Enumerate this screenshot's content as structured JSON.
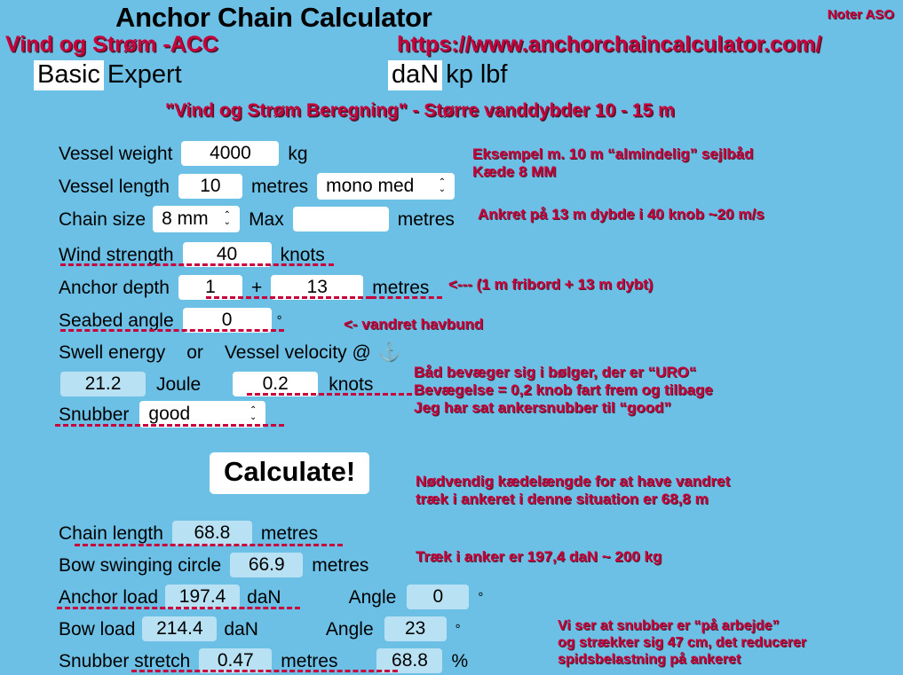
{
  "header": {
    "app_title": "Anchor Chain Calculator",
    "noter": "Noter ASO",
    "subtitle_left": "Vind og Strøm -ACC",
    "url": "https://www.anchorchaincalculator.com/",
    "banner": "\"Vind og Strøm Beregning\" - Større vanddybder 10 - 15 m"
  },
  "mode_tabs": {
    "basic": "Basic",
    "expert": "Expert",
    "selected": "Basic"
  },
  "unit_tabs": {
    "dan": "daN",
    "kp": "kp",
    "lbf": "lbf",
    "selected": "daN"
  },
  "form": {
    "vessel_weight": {
      "label": "Vessel weight",
      "value": "4000",
      "unit": "kg"
    },
    "vessel_length": {
      "label": "Vessel length",
      "value": "10",
      "unit": "metres",
      "hull": "mono med"
    },
    "chain_size": {
      "label": "Chain size",
      "value": "8 mm",
      "max_label": "Max",
      "max_value": "",
      "unit": "metres"
    },
    "wind_strength": {
      "label": "Wind strength",
      "value": "40",
      "unit": "knots"
    },
    "anchor_depth": {
      "label": "Anchor depth",
      "freeboard": "1",
      "plus": "+",
      "depth": "13",
      "unit": "metres"
    },
    "seabed_angle": {
      "label": "Seabed angle",
      "value": "0",
      "unit": "°"
    },
    "swell_row": {
      "swell_label": "Swell energy",
      "or_label": "or",
      "velocity_label": "Vessel velocity @",
      "anchor_icon": "⚓"
    },
    "swell_energy": {
      "value": "21.2",
      "unit": "Joule"
    },
    "vessel_velocity": {
      "value": "0.2",
      "unit": "knots"
    },
    "snubber": {
      "label": "Snubber",
      "value": "good"
    },
    "calculate": "Calculate!"
  },
  "results": {
    "chain_length": {
      "label": "Chain length",
      "value": "68.8",
      "unit": "metres"
    },
    "bow_swinging_circle": {
      "label": "Bow swinging circle",
      "value": "66.9",
      "unit": "metres"
    },
    "anchor_load": {
      "label": "Anchor load",
      "value": "197.4",
      "unit": "daN",
      "angle_label": "Angle",
      "angle_value": "0",
      "angle_unit": "°"
    },
    "bow_load": {
      "label": "Bow load",
      "value": "214.4",
      "unit": "daN",
      "angle_label": "Angle",
      "angle_value": "23",
      "angle_unit": "°"
    },
    "snubber_stretch": {
      "label": "Snubber stretch",
      "value": "0.47",
      "unit": "metres",
      "pct_value": "68.8",
      "pct_unit": "%"
    }
  },
  "notes": {
    "example": "Eksempel m. 10 m “almindelig” sejlbåd\nKæde 8 MM",
    "anchored": "Ankret på 13 m dybde i 40 knob ~20 m/s",
    "depth_arrow": "<--- (1 m fribord + 13 m dybt)",
    "seabed": "<- vandret havbund",
    "motion": "Båd bevæger sig i bølger, der er “URO“\nBevægelse = 0,2 knob fart frem og tilbage\nJeg har sat ankersnubber til “good”",
    "needed_chain": "Nødvendig kædelængde for at have vandret\ntræk i ankeret i denne situation er 68,8 m",
    "anchor_pull": "Træk i anker er 197,4 daN ~ 200 kg",
    "snubber_work": "Vi ser at snubber er “på arbejde”\nog strækker sig 47 cm, det reducerer\nspidsbelastning på ankeret"
  },
  "colors": {
    "background": "#6CC0E5",
    "accent_red": "#C8003C",
    "field_bg": "#FFFFFF",
    "readonly_bg": "#B9E1F4",
    "text": "#000000"
  }
}
